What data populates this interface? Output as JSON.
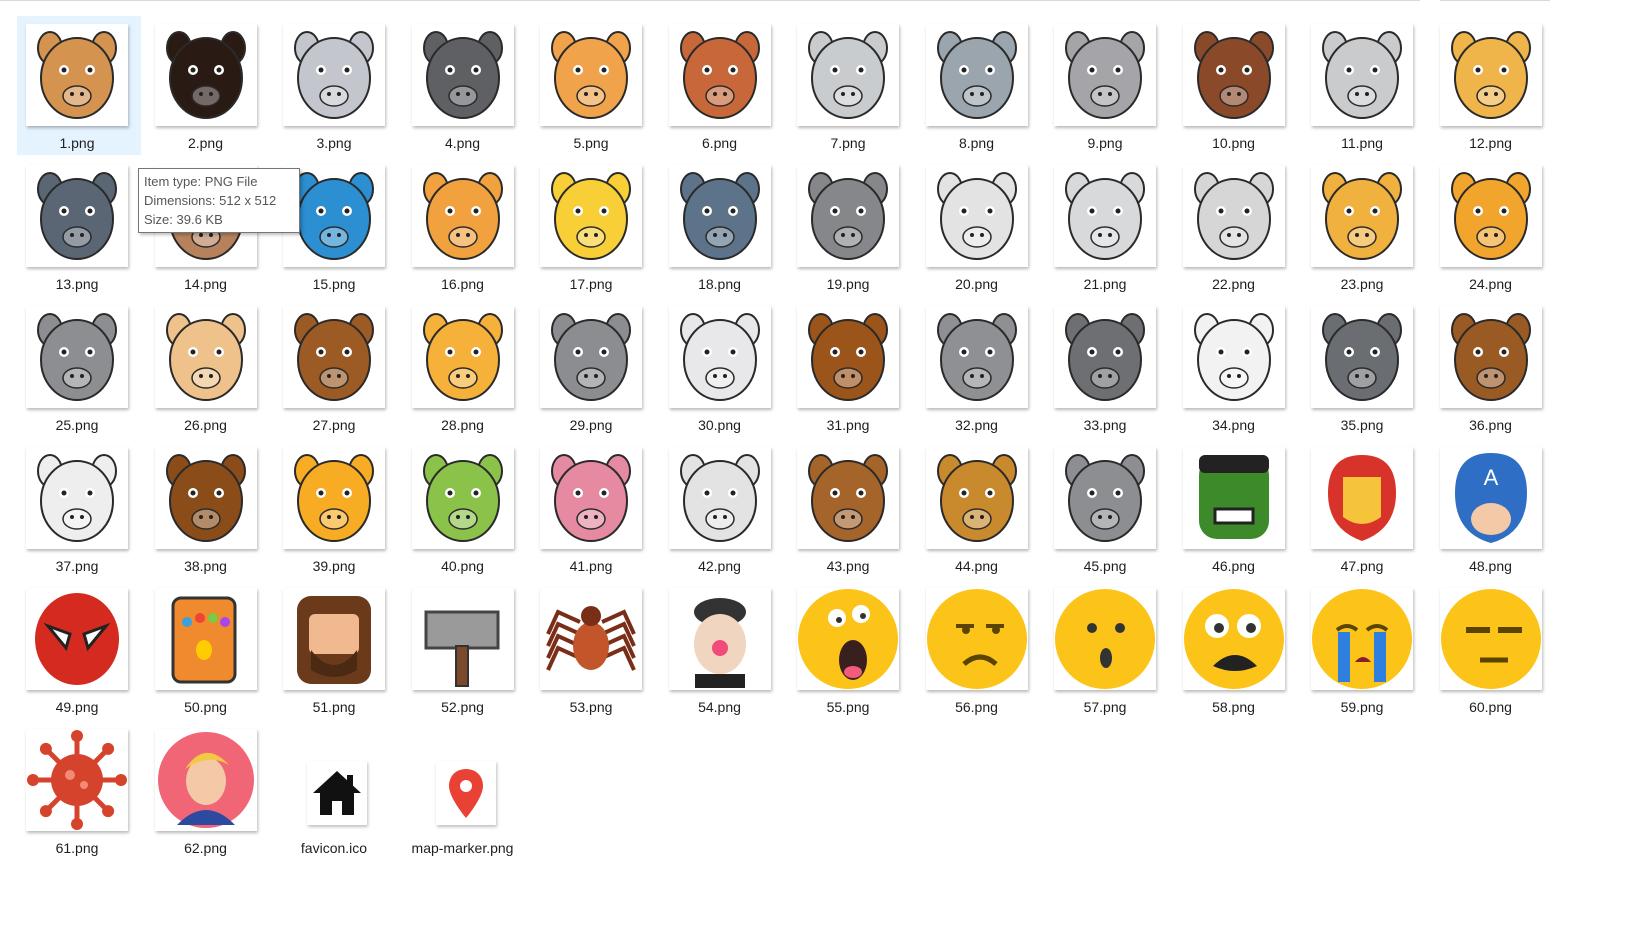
{
  "files": [
    {
      "name": "1.png",
      "icon": "camel-face-icon",
      "color": "#d4934f"
    },
    {
      "name": "2.png",
      "icon": "bull-face-icon",
      "color": "#2a1a14"
    },
    {
      "name": "3.png",
      "icon": "rabbit-face-icon",
      "color": "#c3c6cc"
    },
    {
      "name": "4.png",
      "icon": "cat-face-icon",
      "color": "#5f6064"
    },
    {
      "name": "5.png",
      "icon": "lion-face-icon",
      "color": "#f0a34a"
    },
    {
      "name": "6.png",
      "icon": "monkey-face-icon",
      "color": "#c8683a"
    },
    {
      "name": "7.png",
      "icon": "zebra-face-icon",
      "color": "#c9cccf"
    },
    {
      "name": "8.png",
      "icon": "elephant-face-icon",
      "color": "#9aa5ae"
    },
    {
      "name": "9.png",
      "icon": "seal-face-icon",
      "color": "#a5a4a8"
    },
    {
      "name": "10.png",
      "icon": "horse-face-icon",
      "color": "#8a4a2a"
    },
    {
      "name": "11.png",
      "icon": "goose-face-icon",
      "color": "#c9cbcd"
    },
    {
      "name": "12.png",
      "icon": "giraffe-face-icon",
      "color": "#f0b54a"
    },
    {
      "name": "13.png",
      "icon": "wolf-face-icon",
      "color": "#5b6675"
    },
    {
      "name": "14.png",
      "icon": "dog-face-icon",
      "color": "#b7825b"
    },
    {
      "name": "15.png",
      "icon": "parrot-face-icon",
      "color": "#2b8fd1"
    },
    {
      "name": "16.png",
      "icon": "tiger-face-icon",
      "color": "#f1a23f"
    },
    {
      "name": "17.png",
      "icon": "duck-face-icon",
      "color": "#f8cf36"
    },
    {
      "name": "18.png",
      "icon": "shark-face-icon",
      "color": "#5d7389"
    },
    {
      "name": "19.png",
      "icon": "mouse-face-icon",
      "color": "#85878b"
    },
    {
      "name": "20.png",
      "icon": "cow-face-icon",
      "color": "#e3e3e3"
    },
    {
      "name": "21.png",
      "icon": "white-wolf-face-icon",
      "color": "#d8d9db"
    },
    {
      "name": "22.png",
      "icon": "goat-face-icon",
      "color": "#d6d6d6"
    },
    {
      "name": "23.png",
      "icon": "giraffe-face-icon",
      "color": "#f1b13e"
    },
    {
      "name": "24.png",
      "icon": "fox-face-icon",
      "color": "#f2a52d"
    },
    {
      "name": "25.png",
      "icon": "elephant-face-icon",
      "color": "#8c8e92"
    },
    {
      "name": "26.png",
      "icon": "dog-face-icon",
      "color": "#eec28a"
    },
    {
      "name": "27.png",
      "icon": "deer-face-icon",
      "color": "#9c5a24"
    },
    {
      "name": "28.png",
      "icon": "cat-face-icon",
      "color": "#f6b13a"
    },
    {
      "name": "29.png",
      "icon": "rhino-face-icon",
      "color": "#8b8d91"
    },
    {
      "name": "30.png",
      "icon": "rabbit-face-icon",
      "color": "#e8e8ea"
    },
    {
      "name": "31.png",
      "icon": "horse-face-icon",
      "color": "#9b541a"
    },
    {
      "name": "32.png",
      "icon": "hippo-face-icon",
      "color": "#8e9094"
    },
    {
      "name": "33.png",
      "icon": "gorilla-face-icon",
      "color": "#6d6f72"
    },
    {
      "name": "34.png",
      "icon": "cow-face-icon",
      "color": "#f2f2f2"
    },
    {
      "name": "35.png",
      "icon": "buffalo-face-icon",
      "color": "#6a6d72"
    },
    {
      "name": "36.png",
      "icon": "bear-face-icon",
      "color": "#9a5a24"
    },
    {
      "name": "37.png",
      "icon": "eagle-face-icon",
      "color": "#eeeeee"
    },
    {
      "name": "38.png",
      "icon": "walrus-face-icon",
      "color": "#8a4d1a"
    },
    {
      "name": "39.png",
      "icon": "tiger-face-icon",
      "color": "#f8ac24"
    },
    {
      "name": "40.png",
      "icon": "snake-face-icon",
      "color": "#8bc34a"
    },
    {
      "name": "41.png",
      "icon": "pig-face-icon",
      "color": "#e58aa1"
    },
    {
      "name": "42.png",
      "icon": "panda-face-icon",
      "color": "#e3e3e3"
    },
    {
      "name": "43.png",
      "icon": "monkey-face-icon",
      "color": "#a5652a"
    },
    {
      "name": "44.png",
      "icon": "lion-face-icon",
      "color": "#c98a2e"
    },
    {
      "name": "45.png",
      "icon": "koala-face-icon",
      "color": "#8c8e92"
    },
    {
      "name": "46.png",
      "icon": "hulk-face-icon",
      "color": "#3d8a2a"
    },
    {
      "name": "47.png",
      "icon": "iron-man-face-icon",
      "color": "#d8332b"
    },
    {
      "name": "48.png",
      "icon": "captain-america-face-icon",
      "color": "#2e6fc5"
    },
    {
      "name": "49.png",
      "icon": "spider-man-face-icon",
      "color": "#d42a20"
    },
    {
      "name": "50.png",
      "icon": "gauntlet-icon",
      "color": "#f08a2e"
    },
    {
      "name": "51.png",
      "icon": "bearded-man-face-icon",
      "color": "#6b3a1a"
    },
    {
      "name": "52.png",
      "icon": "hammer-icon",
      "color": "#9a9a9a"
    },
    {
      "name": "53.png",
      "icon": "spider-icon",
      "color": "#c2552a"
    },
    {
      "name": "54.png",
      "icon": "clown-face-icon",
      "color": "#f0d5c0"
    },
    {
      "name": "55.png",
      "icon": "shocked-emoji-icon",
      "color": "#fcc419"
    },
    {
      "name": "56.png",
      "icon": "annoyed-emoji-icon",
      "color": "#fcc419"
    },
    {
      "name": "57.png",
      "icon": "surprised-emoji-icon",
      "color": "#fcc419"
    },
    {
      "name": "58.png",
      "icon": "crazy-emoji-icon",
      "color": "#fcc419"
    },
    {
      "name": "59.png",
      "icon": "crying-emoji-icon",
      "color": "#fcc419"
    },
    {
      "name": "60.png",
      "icon": "expressionless-emoji-icon",
      "color": "#fcc419"
    },
    {
      "name": "61.png",
      "icon": "virus-icon",
      "color": "#d6432c"
    },
    {
      "name": "62.png",
      "icon": "man-portrait-icon",
      "color": "#f06677"
    },
    {
      "name": "favicon.ico",
      "icon": "house-icon",
      "color": "#111111"
    },
    {
      "name": "map-marker.png",
      "icon": "map-marker-icon",
      "color": "#e94235"
    }
  ],
  "selected": "1.png",
  "tooltip": {
    "type": "Item type: PNG File",
    "dimensions": "Dimensions: 512 x 512",
    "size": "Size: 39.6 KB"
  }
}
